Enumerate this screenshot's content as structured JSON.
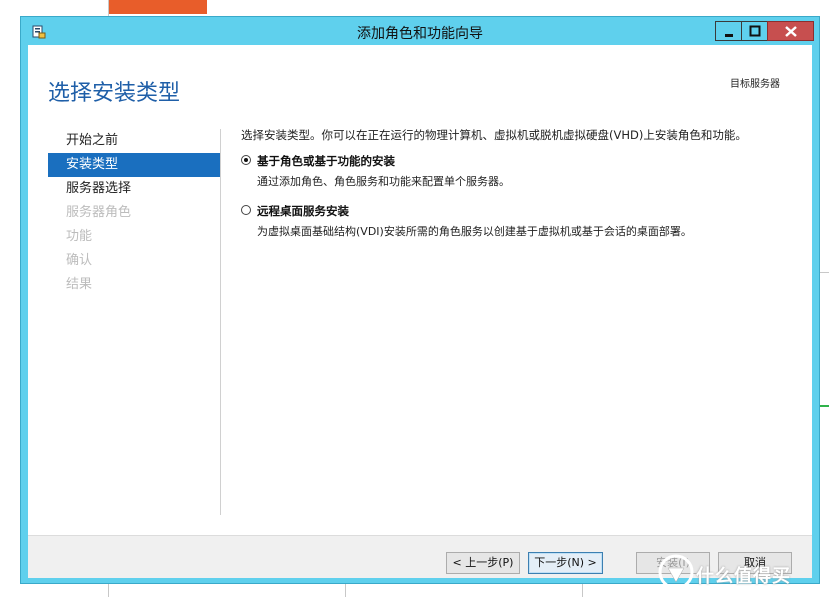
{
  "window": {
    "title": "添加角色和功能向导"
  },
  "header": {
    "page_title": "选择安装类型",
    "target_server_label": "目标服务器"
  },
  "nav": {
    "items": [
      {
        "label": "开始之前",
        "state": "normal"
      },
      {
        "label": "安装类型",
        "state": "active"
      },
      {
        "label": "服务器选择",
        "state": "normal"
      },
      {
        "label": "服务器角色",
        "state": "disabled"
      },
      {
        "label": "功能",
        "state": "disabled"
      },
      {
        "label": "确认",
        "state": "disabled"
      },
      {
        "label": "结果",
        "state": "disabled"
      }
    ]
  },
  "content": {
    "intro": "选择安装类型。你可以在正在运行的物理计算机、虚拟机或脱机虚拟硬盘(VHD)上安装角色和功能。",
    "options": [
      {
        "title": "基于角色或基于功能的安装",
        "description": "通过添加角色、角色服务和功能来配置单个服务器。",
        "selected": true
      },
      {
        "title": "远程桌面服务安装",
        "description": "为虚拟桌面基础结构(VDI)安装所需的角色服务以创建基于虚拟机或基于会话的桌面部署。",
        "selected": false
      }
    ]
  },
  "footer": {
    "prev_label": "< 上一步(P)",
    "next_label": "下一步(N) >",
    "install_label": "安装(I)",
    "cancel_label": "取消"
  },
  "watermark": {
    "text": "什么值得买"
  },
  "colors": {
    "titlebar": "#5fd0ed",
    "accent": "#1a6fbf",
    "page_title": "#1f5fa8",
    "close_button": "#c74f4f"
  }
}
